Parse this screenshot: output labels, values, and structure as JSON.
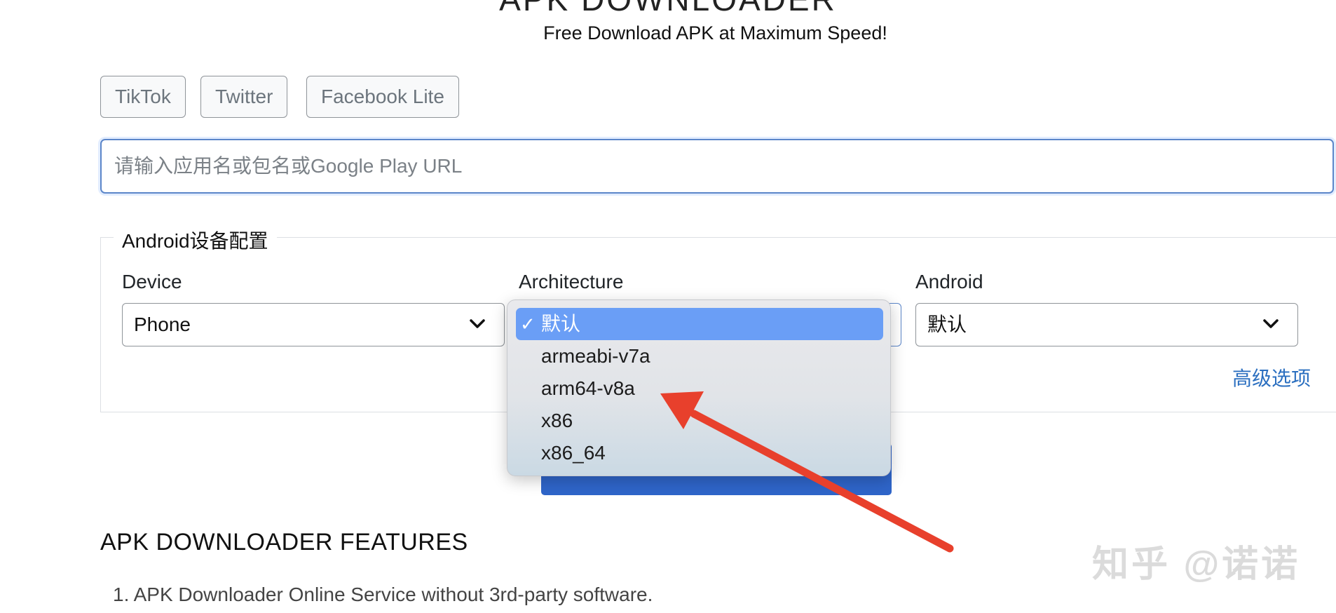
{
  "header": {
    "title": "APK DOWNLOADER",
    "subtitle": "Free Download APK at Maximum Speed!"
  },
  "quick_apps": [
    "TikTok",
    "Twitter",
    "Facebook Lite"
  ],
  "search": {
    "placeholder": "请输入应用名或包名或Google Play URL",
    "value": ""
  },
  "device_config": {
    "legend": "Android设备配置",
    "device": {
      "label": "Device",
      "selected": "Phone"
    },
    "architecture": {
      "label": "Architecture",
      "selected": "默认",
      "options": [
        "默认",
        "armeabi-v7a",
        "arm64-v8a",
        "x86",
        "x86_64"
      ]
    },
    "android": {
      "label": "Android",
      "selected": "默认"
    },
    "advanced_link": "高级选项"
  },
  "features": {
    "heading": "APK DOWNLOADER FEATURES",
    "items": [
      "1. APK Downloader Online Service without 3rd-party software."
    ]
  },
  "watermark": "知乎 @诺诺",
  "colors": {
    "accent": "#2f65c9",
    "link": "#2b6fc0",
    "selected_option": "#6a9ef6",
    "annotation_arrow": "#e8402c"
  },
  "icons": [
    "chevron-down-icon",
    "checkmark-icon",
    "annotation-arrow-icon"
  ]
}
